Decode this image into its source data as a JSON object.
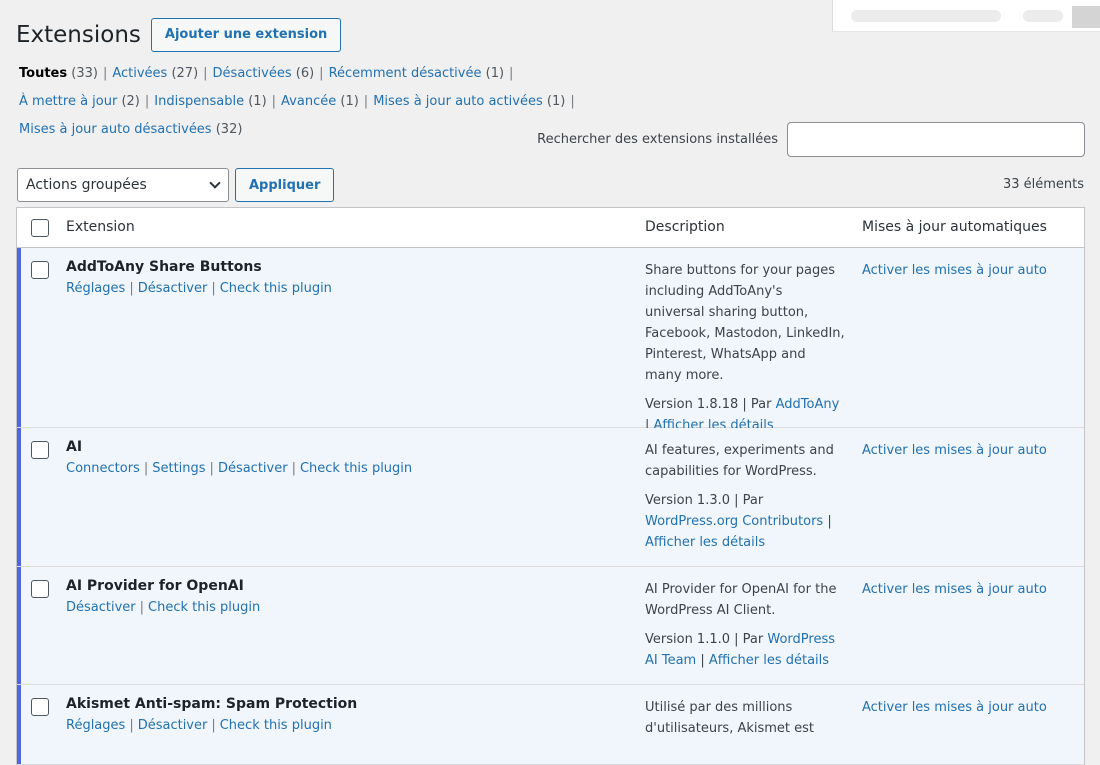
{
  "header": {
    "title": "Extensions",
    "add_button": "Ajouter une extension"
  },
  "filters": [
    {
      "label": "Toutes",
      "count": "(33)",
      "current": true
    },
    {
      "label": "Activées",
      "count": "(27)"
    },
    {
      "label": "Désactivées",
      "count": "(6)"
    },
    {
      "label": "Récemment désactivée",
      "count": "(1)"
    },
    {
      "label": "À mettre à jour",
      "count": "(2)"
    },
    {
      "label": "Indispensable",
      "count": "(1)"
    },
    {
      "label": "Avancée",
      "count": "(1)"
    },
    {
      "label": "Mises à jour auto activées",
      "count": "(1)"
    },
    {
      "label": "Mises à jour auto désactivées",
      "count": "(32)"
    }
  ],
  "search": {
    "label": "Rechercher des extensions installées",
    "value": ""
  },
  "bulk": {
    "select_value": "Actions groupées",
    "apply_label": "Appliquer"
  },
  "items_count": "33 éléments",
  "table": {
    "headers": {
      "extension": "Extension",
      "description": "Description",
      "auto_updates": "Mises à jour automatiques"
    },
    "rows": [
      {
        "name": "AddToAny Share Buttons",
        "actions": [
          "Réglages",
          "Désactiver",
          "Check this plugin"
        ],
        "description": "Share buttons for your pages including AddToAny's universal sharing button, Facebook, Mastodon, LinkedIn, Pinterest, WhatsApp and many more.",
        "version_text": "Version 1.8.18 | Par",
        "author": "AddToAny",
        "details": "Afficher les détails",
        "auto_update": "Activer les mises à jour auto"
      },
      {
        "name": "AI",
        "actions": [
          "Connectors",
          "Settings",
          "Désactiver",
          "Check this plugin"
        ],
        "description": "AI features, experiments and capabilities for WordPress.",
        "version_text": "Version 1.3.0 | Par",
        "author": "WordPress.org Contributors",
        "details": "Afficher les détails",
        "auto_update": "Activer les mises à jour auto"
      },
      {
        "name": "AI Provider for OpenAI",
        "actions": [
          "Désactiver",
          "Check this plugin"
        ],
        "description": "AI Provider for OpenAI for the WordPress AI Client.",
        "version_text": "Version 1.1.0 | Par",
        "author": "WordPress AI Team",
        "details": "Afficher les détails",
        "auto_update": "Activer les mises à jour auto"
      },
      {
        "name": "Akismet Anti-spam: Spam Protection",
        "actions": [
          "Réglages",
          "Désactiver",
          "Check this plugin"
        ],
        "description": "Utilisé par des millions d'utilisateurs, Akismet est",
        "version_text": "",
        "author": "",
        "details": "",
        "auto_update": "Activer les mises à jour auto"
      }
    ]
  },
  "colors": {
    "link": "#2271b1",
    "active_row_bg": "#f0f6fc",
    "active_bar": "#4f66e0"
  }
}
